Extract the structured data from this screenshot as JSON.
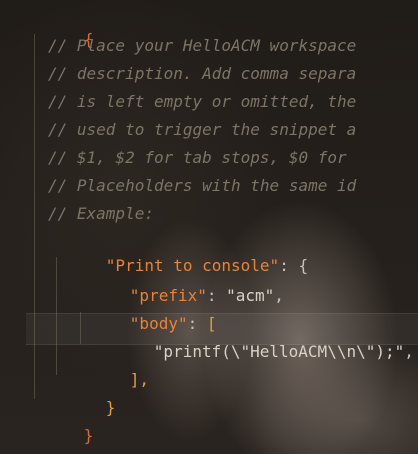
{
  "editor": {
    "lines": {
      "open_brace": "{",
      "comment_1": "// Place your HelloACM workspace",
      "comment_2": "// description. Add comma separa",
      "comment_3": "// is left empty or omitted, the",
      "comment_4": "// used to trigger the snippet a",
      "comment_5": "// $1, $2 for tab stops, $0 for",
      "comment_6": "// Placeholders with the same id",
      "comment_7": "// Example:",
      "snippet_key": "\"Print to console\"",
      "snippet_open": ": {",
      "prefix_key": "\"prefix\"",
      "prefix_sep": ": ",
      "prefix_value": "\"acm\"",
      "prefix_comma": ",",
      "body_key": "\"body\"",
      "body_sep": ": ",
      "body_open": "[",
      "body_value": "\"printf(\\\"HelloACM\\\\n\\\");\"",
      "body_comma": ",",
      "body_close": "],",
      "snippet_close": "}",
      "close_brace": "}"
    }
  }
}
